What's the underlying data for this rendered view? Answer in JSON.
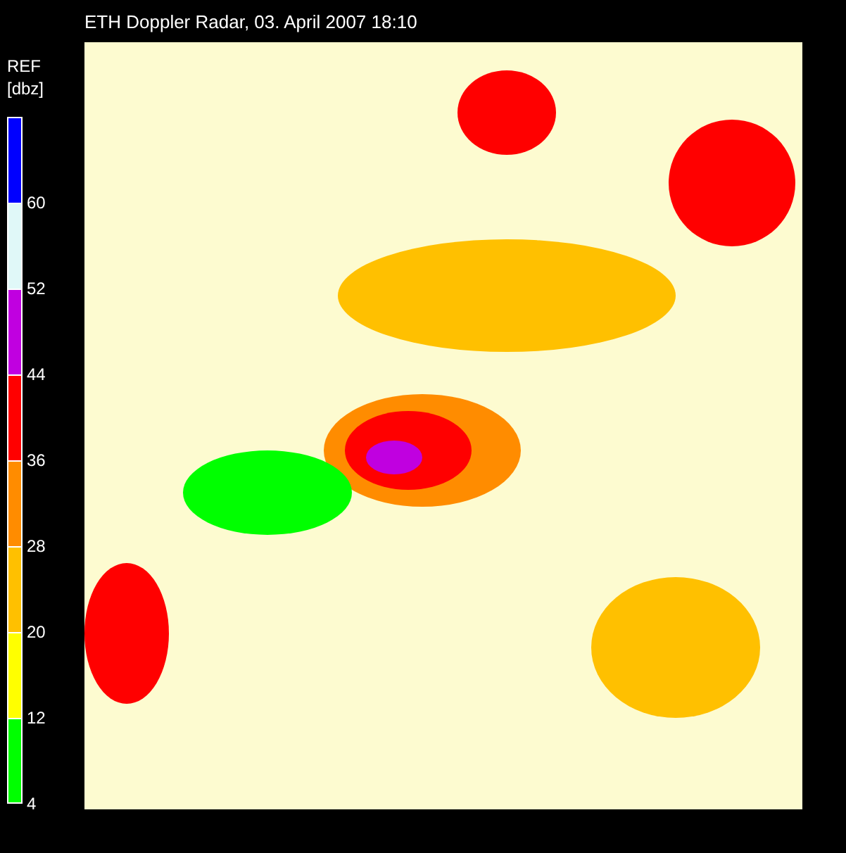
{
  "window": {
    "title": "ETH Doppler Radar, 03. April 2007 18:10"
  },
  "legend": {
    "title": "REF",
    "unit": "[dbz]",
    "segments": [
      {
        "color": "#0000ff",
        "label": "60"
      },
      {
        "color": "#e0f8f8",
        "label": "52"
      },
      {
        "color": "#c000e0",
        "label": "44"
      },
      {
        "color": "#ff0000",
        "label": "36"
      },
      {
        "color": "#ff8c00",
        "label": "28"
      },
      {
        "color": "#ffc000",
        "label": "20"
      },
      {
        "color": "#ffff00",
        "label": "12"
      },
      {
        "color": "#00ff00",
        "label": "4"
      }
    ]
  }
}
